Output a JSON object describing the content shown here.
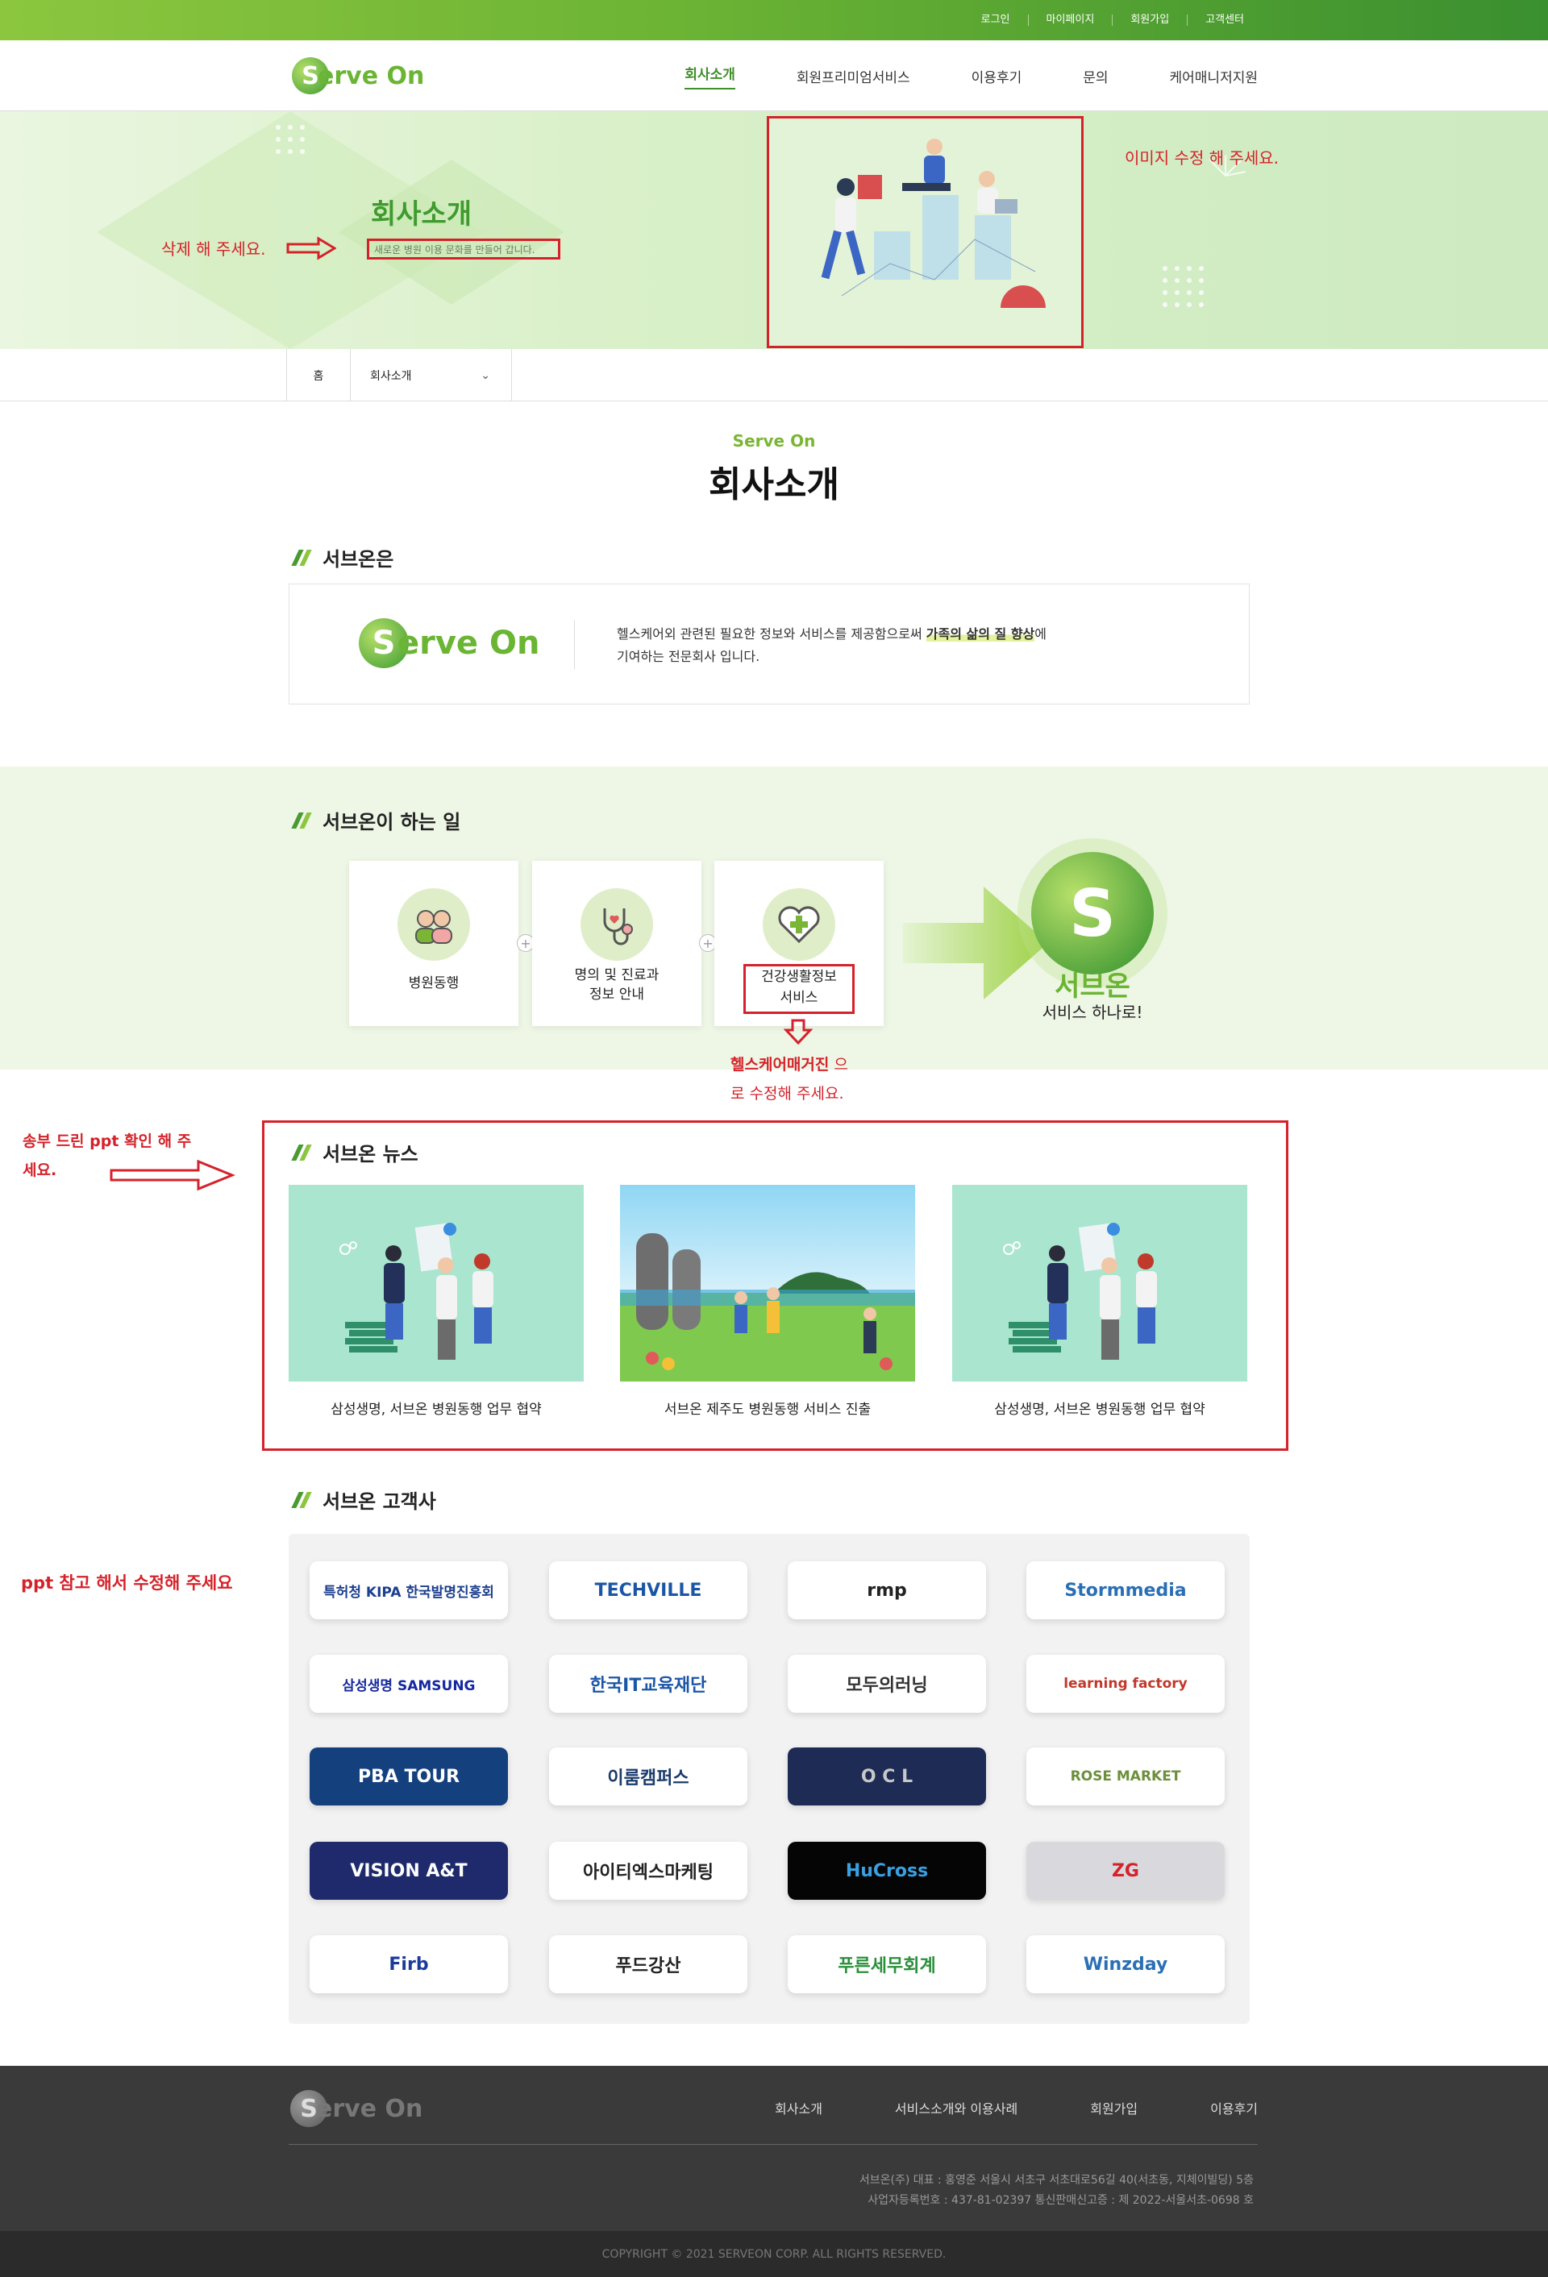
{
  "topbar": {
    "links": [
      "로그인",
      "마이페이지",
      "회원가입",
      "고객센터"
    ]
  },
  "header": {
    "logo_letter": "S",
    "logo_text": "erve On",
    "nav": [
      "회사소개",
      "회원프리미엄서비스",
      "이용후기",
      "문의",
      "케어매니저지원"
    ],
    "active_index": 0
  },
  "hero": {
    "title": "회사소개",
    "subtitle": "새로운 병원 이용 문화를 만들어 갑니다.",
    "annot_delete": "삭제 해 주세요.",
    "annot_image": "이미지 수정 해 주세요."
  },
  "breadcrumb": {
    "home": "홈",
    "current": "회사소개"
  },
  "page_head": {
    "eyebrow": "Serve On",
    "title": "회사소개"
  },
  "about": {
    "section_title": "서브온은",
    "logo_letter": "S",
    "logo_text": "erve On",
    "text_1": "헬스케어외 관련된 필요한 정보와 서비스를 제공함으로써 ",
    "text_highlight": "가족의 삶의 질 향상",
    "text_2": "에",
    "text_3": "기여하는 전문회사 입니다."
  },
  "work": {
    "section_title": "서브온이 하는 일",
    "cards": [
      {
        "icon": "people-icon",
        "label": "병원동행"
      },
      {
        "icon": "stethoscope-icon",
        "label": "명의 및 진료과\n정보 안내"
      },
      {
        "icon": "heart-plus-icon",
        "label": "건강생활정보\n서비스"
      }
    ],
    "plus": "+",
    "brand_letter": "S",
    "brand_name": "서브온",
    "brand_tagline": "서비스 하나로!",
    "annot_1": "헬스케어매거진",
    "annot_2": " 으",
    "annot_3": "로 수정해 주세요."
  },
  "news": {
    "section_title": "서브온 뉴스",
    "items": [
      {
        "caption": "삼성생명, 서브온 병원동행 업무 협약"
      },
      {
        "caption": "서브온 제주도 병원동행 서비스 진출"
      },
      {
        "caption": "삼성생명, 서브온 병원동행 업무 협약"
      }
    ],
    "annot": "송부 드린 ppt 확인 해 주\n세요."
  },
  "clients": {
    "section_title": "서브온 고객사",
    "annot": "ppt 참고 해서 수정해 주세요",
    "logos": [
      {
        "text": "특허청 KIPA 한국발명진흥회",
        "bg": "#ffffff",
        "color": "#1c3f8f"
      },
      {
        "text": "TECHVILLE",
        "bg": "#ffffff",
        "color": "#1b56a6"
      },
      {
        "text": "rmp",
        "bg": "#ffffff",
        "color": "#222222"
      },
      {
        "text": "Stormmedia",
        "bg": "#ffffff",
        "color": "#2a6fb5"
      },
      {
        "text": "삼성생명 SAMSUNG",
        "bg": "#ffffff",
        "color": "#1428a0"
      },
      {
        "text": "한국IT교육재단",
        "bg": "#ffffff",
        "color": "#1b56a6"
      },
      {
        "text": "모두의러닝",
        "bg": "#ffffff",
        "color": "#333333"
      },
      {
        "text": "learning factory",
        "bg": "#ffffff",
        "color": "#c0392b"
      },
      {
        "text": "PBA TOUR",
        "bg": "#14407e",
        "color": "#ffffff"
      },
      {
        "text": "이룸캠퍼스",
        "bg": "#ffffff",
        "color": "#1b3a6b"
      },
      {
        "text": "O C L",
        "bg": "#1e2b55",
        "color": "#c8c8c8"
      },
      {
        "text": "ROSE MARKET",
        "bg": "#ffffff",
        "color": "#6b8f3a"
      },
      {
        "text": "VISION A&T",
        "bg": "#1e2a6b",
        "color": "#ffffff"
      },
      {
        "text": "아이티엑스마케팅",
        "bg": "#ffffff",
        "color": "#222222"
      },
      {
        "text": "HuCross",
        "bg": "#050505",
        "color": "#3aa0e0"
      },
      {
        "text": "ZG",
        "bg": "#d9d9dd",
        "color": "#d5222a"
      },
      {
        "text": "Firb",
        "bg": "#ffffff",
        "color": "#1b3a9b"
      },
      {
        "text": "푸드강산",
        "bg": "#ffffff",
        "color": "#222222"
      },
      {
        "text": "푸른세무회계",
        "bg": "#ffffff",
        "color": "#2a8f3a"
      },
      {
        "text": "Winzday",
        "bg": "#ffffff",
        "color": "#2a6fb5"
      }
    ]
  },
  "footer": {
    "logo_letter": "S",
    "logo_text": "erve On",
    "menu": [
      "회사소개",
      "서비스소개와 이용사례",
      "회원가입",
      "이용후기"
    ],
    "info_1": "서브온(주) 대표 : 홍영준 서울시 서초구 서초대로56길 40(서초동, 지체이빌딩) 5층",
    "info_2": "사업자등록번호 : 437-81-02397 통신판매신고증 : 제 2022-서울서초-0698 호",
    "copyright": "COPYRIGHT © 2021 SERVEON CORP. ALL RIGHTS RESERVED."
  },
  "colors": {
    "brand_green": "#6ab533",
    "annotation_red": "#d5222a"
  }
}
